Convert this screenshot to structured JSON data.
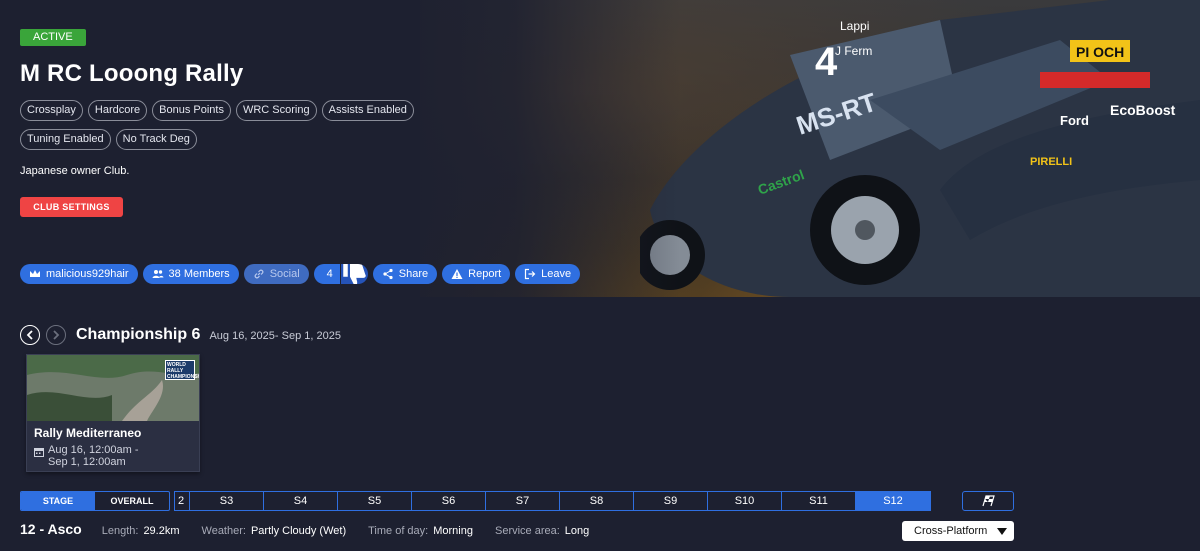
{
  "club": {
    "status_badge": "ACTIVE",
    "title": "M RC Looong Rally",
    "tags": [
      "Crossplay",
      "Hardcore",
      "Bonus Points",
      "WRC Scoring",
      "Assists Enabled",
      "Tuning Enabled",
      "No Track Deg"
    ],
    "description": "Japanese owner Club.",
    "settings_button": "CLUB SETTINGS"
  },
  "actions": {
    "owner": "malicious929hair",
    "members": "38 Members",
    "social": "Social",
    "likes": "4",
    "share": "Share",
    "report": "Report",
    "leave": "Leave"
  },
  "championship": {
    "name": "Championship 6",
    "dates": "Aug 16, 2025- Sep 1, 2025"
  },
  "event": {
    "name": "Rally Mediterraneo",
    "date_line1": "Aug 16, 12:00am -",
    "date_line2": "Sep 1, 12:00am",
    "logo_text": "WORLD RALLY CHAMPIONSHIP"
  },
  "mode_tabs": {
    "stage": "STAGE",
    "overall": "OVERALL"
  },
  "stage_tabs": [
    "2",
    "S3",
    "S4",
    "S5",
    "S6",
    "S7",
    "S8",
    "S9",
    "S10",
    "S11",
    "S12"
  ],
  "active_stage_tab": "S12",
  "stage": {
    "title": "12 - Asco",
    "length_label": "Length:",
    "length": "29.2km",
    "weather_label": "Weather:",
    "weather": "Partly Cloudy (Wet)",
    "time_label": "Time of day:",
    "time": "Morning",
    "service_label": "Service area:",
    "service": "Long"
  },
  "platform_select": {
    "value": "Cross-Platform"
  },
  "colors": {
    "accent": "#2f6fe0",
    "danger": "#ef4444",
    "active_badge": "#3aa53a",
    "background": "#1d2030"
  },
  "hero_livery": {
    "number": "4",
    "crew": [
      "Lappi",
      "J Ferm"
    ],
    "brand": "MS-RT",
    "plate": "PI OCH",
    "sponsors": [
      "Castrol",
      "Ford",
      "EcoBoost",
      "PIRELLI"
    ]
  }
}
